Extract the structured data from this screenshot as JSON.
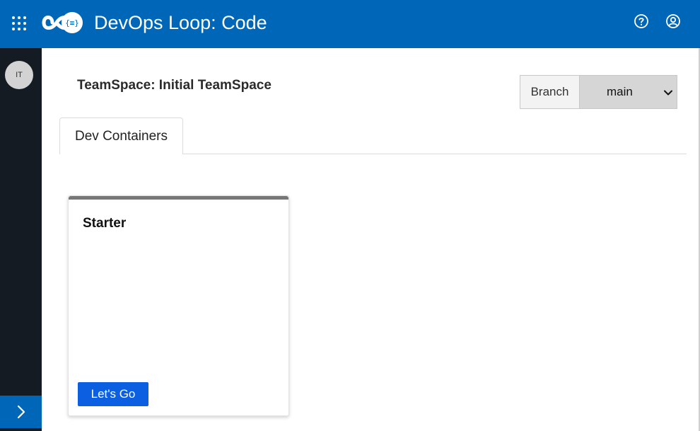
{
  "header": {
    "app_title": "DevOps Loop: Code",
    "icons": [
      "app-launcher-icon",
      "devops-loop-logo-icon",
      "help-icon",
      "user-icon"
    ],
    "bar_color": "#0067b8"
  },
  "rail": {
    "avatar_initials": "IT",
    "expand_icon": "chevron-right-icon",
    "rail_color": "#141b22"
  },
  "main": {
    "teamspace_title": "TeamSpace: Initial TeamSpace",
    "branch": {
      "label": "Branch",
      "selected": "main"
    },
    "tabs": [
      {
        "label": "Dev Containers"
      }
    ],
    "cards": [
      {
        "title": "Starter",
        "action_label": "Let's Go"
      }
    ],
    "accent_color": "#0b5fe0"
  }
}
